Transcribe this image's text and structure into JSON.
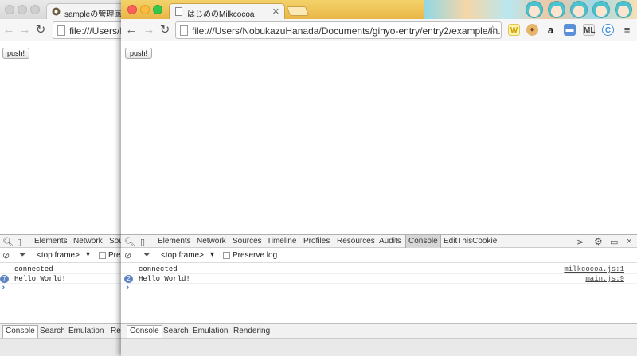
{
  "back_window": {
    "tab_title": "sampleの管理画面",
    "address": "file:///Users/No",
    "push_label": "push!",
    "devtools_tabs": [
      "Elements",
      "Network",
      "Sou"
    ],
    "frame_selector": "<top frame>",
    "preserve_label": "Pres",
    "logs": [
      {
        "text": "connected"
      },
      {
        "text": "Hello World!",
        "count": "7"
      }
    ],
    "drawer_tabs": [
      "Console",
      "Search",
      "Emulation",
      "Re"
    ]
  },
  "front_window": {
    "tab_title": "はじめのMilkcocoa",
    "address": "file:///Users/NobukazuHanada/Documents/gihyo-entry/entry2/example/in...",
    "push_label": "push!",
    "devtools_tabs": [
      "Elements",
      "Network",
      "Sources",
      "Timeline",
      "Profiles",
      "Resources",
      "Audits",
      "Console",
      "EditThisCookie"
    ],
    "active_tab": "Console",
    "frame_selector": "<top frame>",
    "preserve_label": "Preserve log",
    "logs": [
      {
        "text": "connected",
        "source": "milkcocoa.js:1"
      },
      {
        "text": "Hello World!",
        "source": "main.js:9",
        "count": "2"
      }
    ],
    "drawer_tabs": [
      "Console",
      "Search",
      "Emulation",
      "Rendering"
    ],
    "extensions": [
      "w-icon",
      "cookie-icon",
      "amazon-icon",
      "chat-icon",
      "ml-icon",
      "c-icon",
      "menu-icon"
    ]
  },
  "colors": {
    "titlebar_active": "#eab647",
    "console_prompt": "#3a78d1",
    "repeat_badge": "#5e83c2"
  }
}
